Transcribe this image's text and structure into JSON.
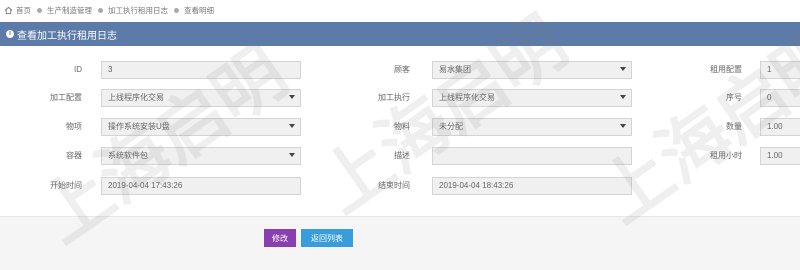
{
  "breadcrumb": [
    "首页",
    "生产制造管理",
    "加工执行租用日志",
    "查看明细"
  ],
  "title": "查看加工执行租用日志",
  "form": {
    "id": {
      "label": "ID",
      "value": "3"
    },
    "customer": {
      "label": "顾客",
      "value": "易水集团"
    },
    "rent_config": {
      "label": "租用配置",
      "value": "1"
    },
    "process_config": {
      "label": "加工配置",
      "value": "上线程序化交易"
    },
    "process_exec": {
      "label": "加工执行",
      "value": "上线程序化交易"
    },
    "seq_no": {
      "label": "序号",
      "value": "0"
    },
    "item": {
      "label": "物项",
      "value": "操作系统安装U盘"
    },
    "material": {
      "label": "物料",
      "value": "未分配"
    },
    "quantity": {
      "label": "数量",
      "value": "1.00"
    },
    "container": {
      "label": "容器",
      "value": "系统软件包"
    },
    "description": {
      "label": "描述",
      "value": ""
    },
    "rent_hours": {
      "label": "租用小时",
      "value": "1.00"
    },
    "start_time": {
      "label": "开始时间",
      "value": "2019-04-04 17:43:26"
    },
    "end_time": {
      "label": "结束时间",
      "value": "2019-04-04 18:43:26"
    }
  },
  "buttons": {
    "edit": "修改",
    "back": "返回列表"
  },
  "watermark": "上海启明"
}
